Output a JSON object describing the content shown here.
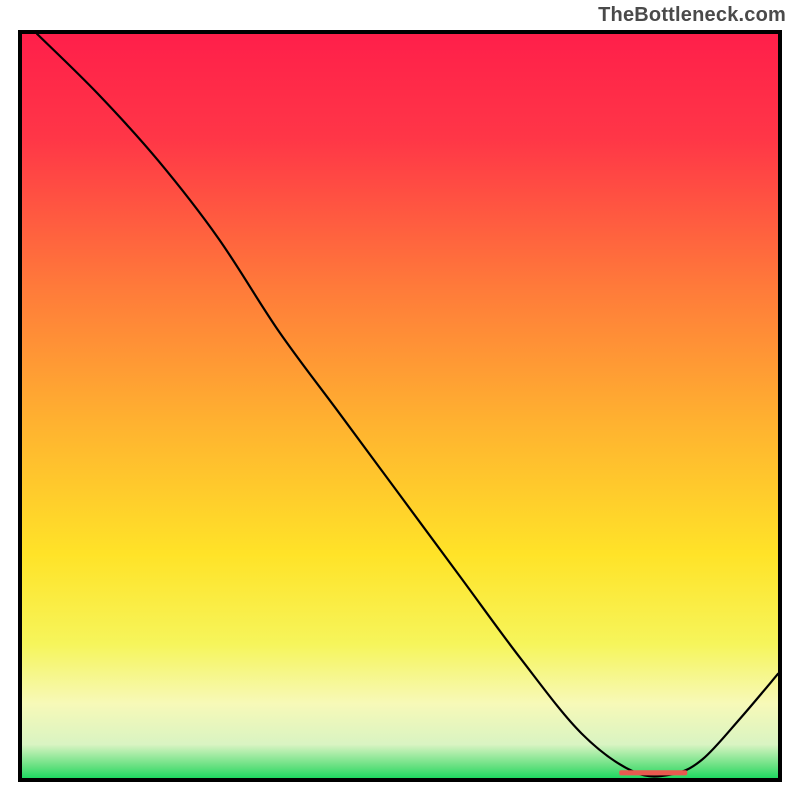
{
  "watermark": "TheBottleneck.com",
  "chart_data": {
    "type": "line",
    "title": "",
    "xlabel": "",
    "ylabel": "",
    "xlim": [
      0,
      100
    ],
    "ylim": [
      0,
      100
    ],
    "background_gradient_stops": [
      {
        "offset": 0.0,
        "color": "#ff1f4a"
      },
      {
        "offset": 0.14,
        "color": "#ff3647"
      },
      {
        "offset": 0.34,
        "color": "#ff7a3a"
      },
      {
        "offset": 0.52,
        "color": "#ffb130"
      },
      {
        "offset": 0.7,
        "color": "#ffe328"
      },
      {
        "offset": 0.82,
        "color": "#f6f55b"
      },
      {
        "offset": 0.9,
        "color": "#f7f9b8"
      },
      {
        "offset": 0.955,
        "color": "#d9f4c2"
      },
      {
        "offset": 0.985,
        "color": "#63e07f"
      },
      {
        "offset": 1.0,
        "color": "#1fd861"
      }
    ],
    "series": [
      {
        "name": "bottleneck-curve",
        "x": [
          2,
          10,
          18,
          26,
          34,
          42,
          50,
          58,
          66,
          74,
          81,
          86,
          90,
          95,
          100
        ],
        "y": [
          100,
          92,
          83,
          72.5,
          60,
          49,
          38,
          27,
          16,
          6,
          0.8,
          0.5,
          2.5,
          8,
          14
        ]
      }
    ],
    "marker": {
      "name": "optimal-range",
      "x_start": 79,
      "x_end": 88,
      "y": 0.7,
      "color": "#e85a4f"
    }
  }
}
